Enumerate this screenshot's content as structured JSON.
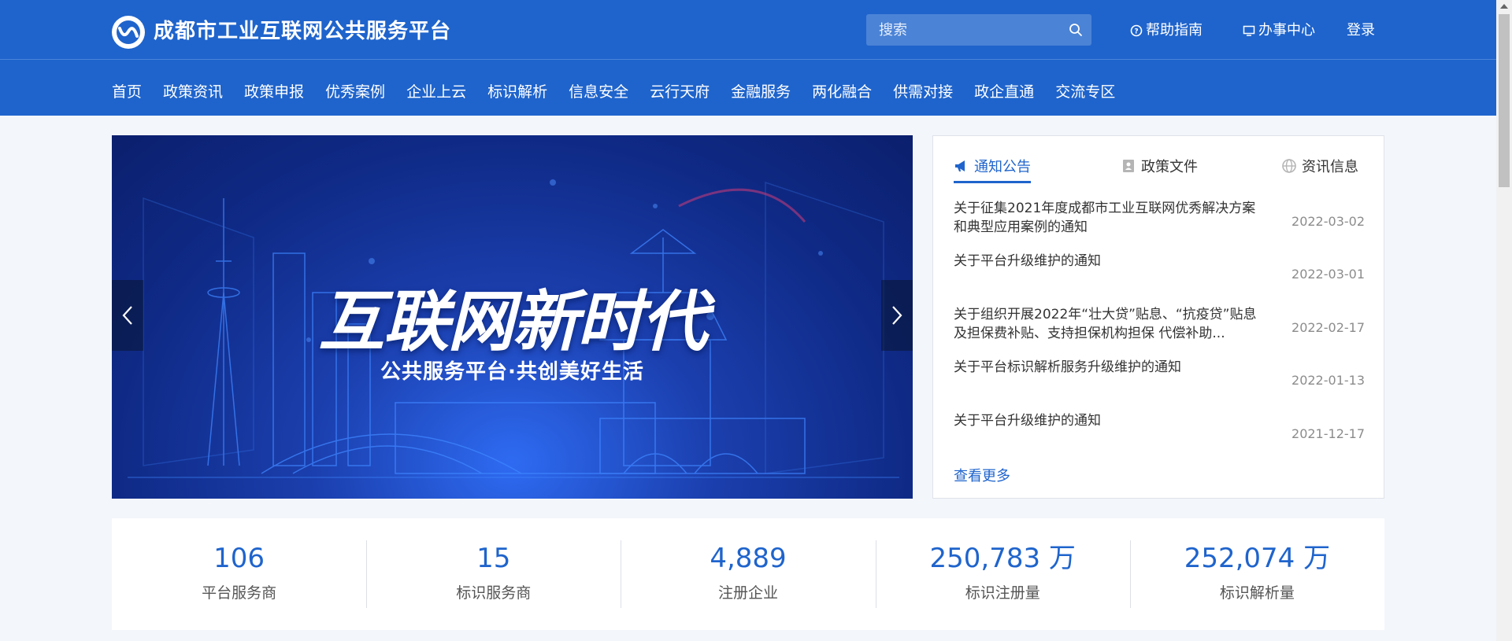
{
  "header": {
    "site_title": "成都市工业互联网公共服务平台",
    "search_placeholder": "搜索",
    "help_label": "帮助指南",
    "office_label": "办事中心",
    "login_label": "登录"
  },
  "nav": [
    "首页",
    "政策资讯",
    "政策申报",
    "优秀案例",
    "企业上云",
    "标识解析",
    "信息安全",
    "云行天府",
    "金融服务",
    "两化融合",
    "供需对接",
    "政企直通",
    "交流专区"
  ],
  "banner": {
    "title": "互联网新时代",
    "subtitle": "公共服务平台·共创美好生活"
  },
  "notices": {
    "tabs": [
      {
        "label": "通知公告",
        "icon": "megaphone-icon",
        "active": true
      },
      {
        "label": "政策文件",
        "icon": "document-icon",
        "active": false
      },
      {
        "label": "资讯信息",
        "icon": "globe-icon",
        "active": false
      }
    ],
    "items": [
      {
        "title": "关于征集2021年度成都市工业互联网优秀解决方案和典型应用案例的通知",
        "date": "2022-03-02"
      },
      {
        "title": "关于平台升级维护的通知",
        "date": "2022-03-01"
      },
      {
        "title": "关于组织开展2022年“壮大贷”贴息、“抗疫贷”贴息及担保费补贴、支持担保机构担保 代偿补助...",
        "date": "2022-02-17"
      },
      {
        "title": "关于平台标识解析服务升级维护的通知",
        "date": "2022-01-13"
      },
      {
        "title": "关于平台升级维护的通知",
        "date": "2021-12-17"
      }
    ],
    "more_label": "查看更多"
  },
  "stats": [
    {
      "value": "106",
      "label": "平台服务商"
    },
    {
      "value": "15",
      "label": "标识服务商"
    },
    {
      "value": "4,889",
      "label": "注册企业"
    },
    {
      "value": "250,783 万",
      "label": "标识注册量"
    },
    {
      "value": "252,074 万",
      "label": "标识解析量"
    }
  ],
  "colors": {
    "primary": "#1f64cc",
    "background": "#f3f6fb"
  }
}
